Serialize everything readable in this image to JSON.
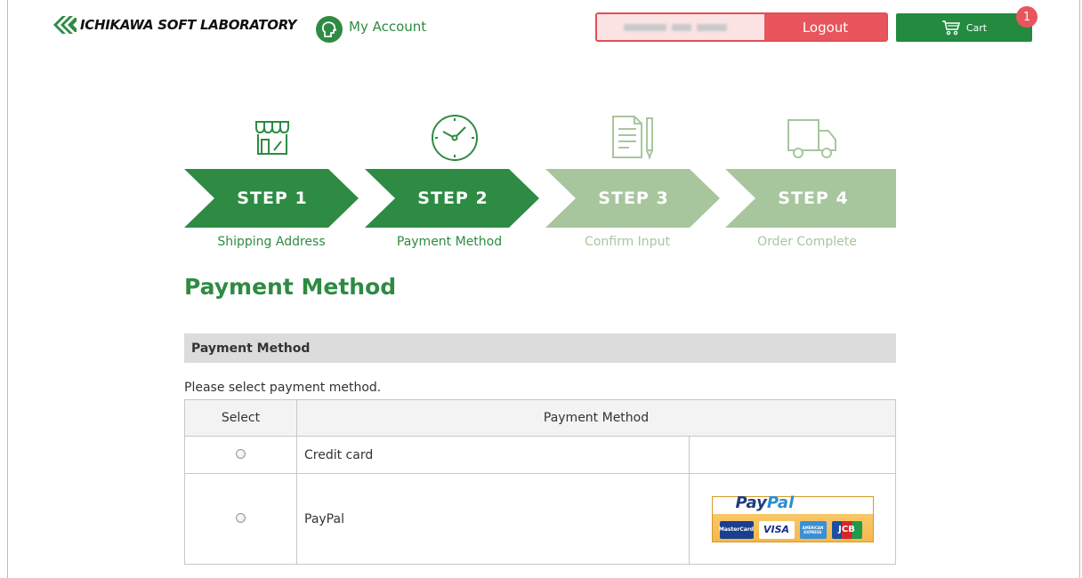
{
  "header": {
    "logo_text": "ICHIKAWA SOFT LABORATORY",
    "account_label": "My Account",
    "logout_label": "Logout",
    "cart_label": "Cart",
    "cart_count": "1"
  },
  "steps": [
    {
      "label": "STEP 1",
      "caption": "Shipping Address",
      "state": "done",
      "icon": "shop-icon"
    },
    {
      "label": "STEP 2",
      "caption": "Payment Method",
      "state": "current",
      "icon": "clock-icon"
    },
    {
      "label": "STEP 3",
      "caption": "Confirm Input",
      "state": "pending",
      "icon": "document-pen-icon"
    },
    {
      "label": "STEP 4",
      "caption": "Order Complete",
      "state": "pending",
      "icon": "truck-icon"
    }
  ],
  "page_title": "Payment Method",
  "section_title": "Payment Method",
  "instruction": "Please select payment method.",
  "table": {
    "headers": [
      "Select",
      "Payment Method"
    ],
    "rows": [
      {
        "method": "Credit card",
        "logo": ""
      },
      {
        "method": "PayPal",
        "logo": "paypal-logo"
      }
    ]
  },
  "paypal_logo": {
    "word1": "Pay",
    "word2": "Pal",
    "cards": [
      "MasterCard",
      "VISA",
      "AMERICAN EXPRESS",
      "JCB"
    ]
  },
  "colors": {
    "green": "#2e8b43",
    "green_light": "#a8c69e",
    "red": "#e9555c"
  }
}
